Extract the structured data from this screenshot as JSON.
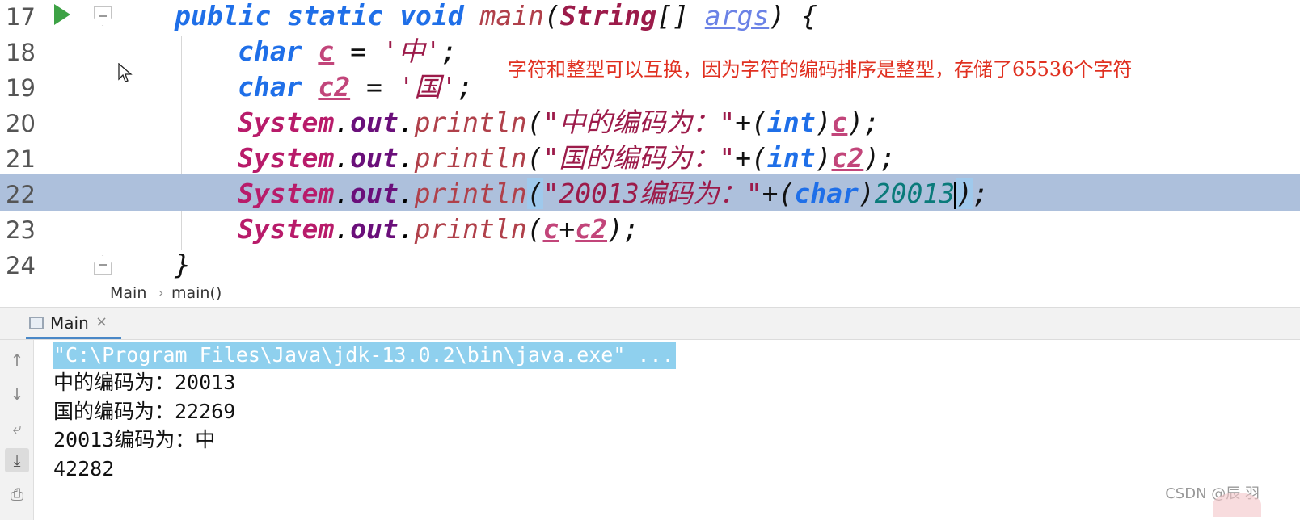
{
  "editor": {
    "lines": [
      {
        "num": "17"
      },
      {
        "num": "18"
      },
      {
        "num": "19"
      },
      {
        "num": "20"
      },
      {
        "num": "21"
      },
      {
        "num": "22"
      },
      {
        "num": "23"
      },
      {
        "num": "24"
      }
    ],
    "tokens": {
      "l17": [
        "public",
        "static",
        "void",
        "main",
        "(",
        "String",
        "[]",
        "args",
        ")",
        "{"
      ],
      "l18": [
        "char",
        "c",
        "=",
        "'中'",
        ";"
      ],
      "l19": [
        "char",
        "c2",
        "=",
        "'国'",
        ";"
      ],
      "l20": [
        "System",
        ".",
        "out",
        ".",
        "println",
        "(",
        "\"中的编码为：\"",
        "+",
        "(",
        "int",
        ")",
        "c",
        ")",
        ";"
      ],
      "l21": [
        "System",
        ".",
        "out",
        ".",
        "println",
        "(",
        "\"国的编码为：\"",
        "+",
        "(",
        "int",
        ")",
        "c2",
        ")",
        ";"
      ],
      "l22": [
        "System",
        ".",
        "out",
        ".",
        "println",
        "(",
        "\"20013编码为：\"",
        "+",
        "(",
        "char",
        ")",
        "20013",
        ")",
        ";"
      ],
      "l23": [
        "System",
        ".",
        "out",
        ".",
        "println",
        "(",
        "c",
        "+",
        "c2",
        ")",
        ";"
      ],
      "l24": [
        "}"
      ]
    },
    "current_line": "22",
    "annotation": "字符和整型可以互换，因为字符的编码排序是整型，存储了65536个字符",
    "annotation_color": "#e03020"
  },
  "breadcrumb": [
    "Main",
    "main()"
  ],
  "run_panel": {
    "tab_label": "Main",
    "tab_close": "×",
    "command": "\"C:\\Program Files\\Java\\jdk-13.0.2\\bin\\java.exe\" ...",
    "output": [
      "中的编码为：20013",
      "国的编码为：22269",
      "20013编码为：中",
      "42282"
    ],
    "toolbar_icons": [
      "arrow-up-icon",
      "arrow-down-icon",
      "soft-wrap-icon",
      "scroll-to-end-icon",
      "print-icon"
    ]
  },
  "watermark": "CSDN @辰 羽",
  "colors": {
    "keyword": "#1f6fe8",
    "current_line_bg": "#adc0dc",
    "run_icon": "#3da245",
    "command_highlight": "#8fd0ee"
  }
}
